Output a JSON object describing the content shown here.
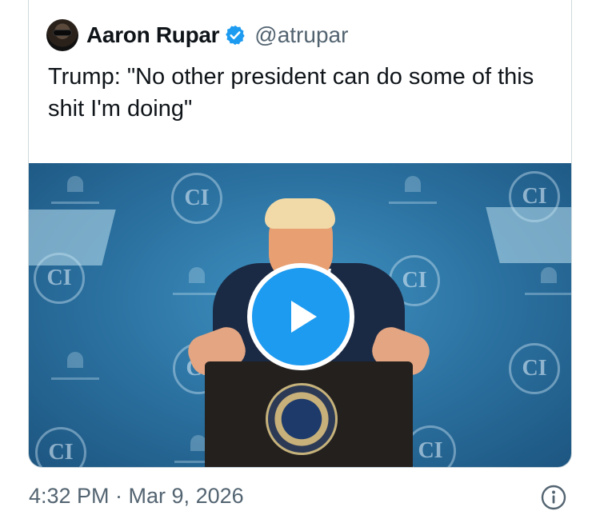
{
  "quote": {
    "author_name": "Aaron Rupar",
    "author_handle": "@atrupar",
    "verified": true,
    "text": "Trump: \"No other president can do some of this shit I'm doing\"",
    "media": {
      "type": "video",
      "play_icon": "play-icon",
      "backdrop_logo": "CI"
    }
  },
  "footer": {
    "timestamp": "4:32 PM · Mar 9, 2026",
    "info_icon": "info-icon"
  },
  "colors": {
    "accent": "#1d9bf0",
    "secondary_text": "#536471",
    "border": "#cfd9de"
  }
}
